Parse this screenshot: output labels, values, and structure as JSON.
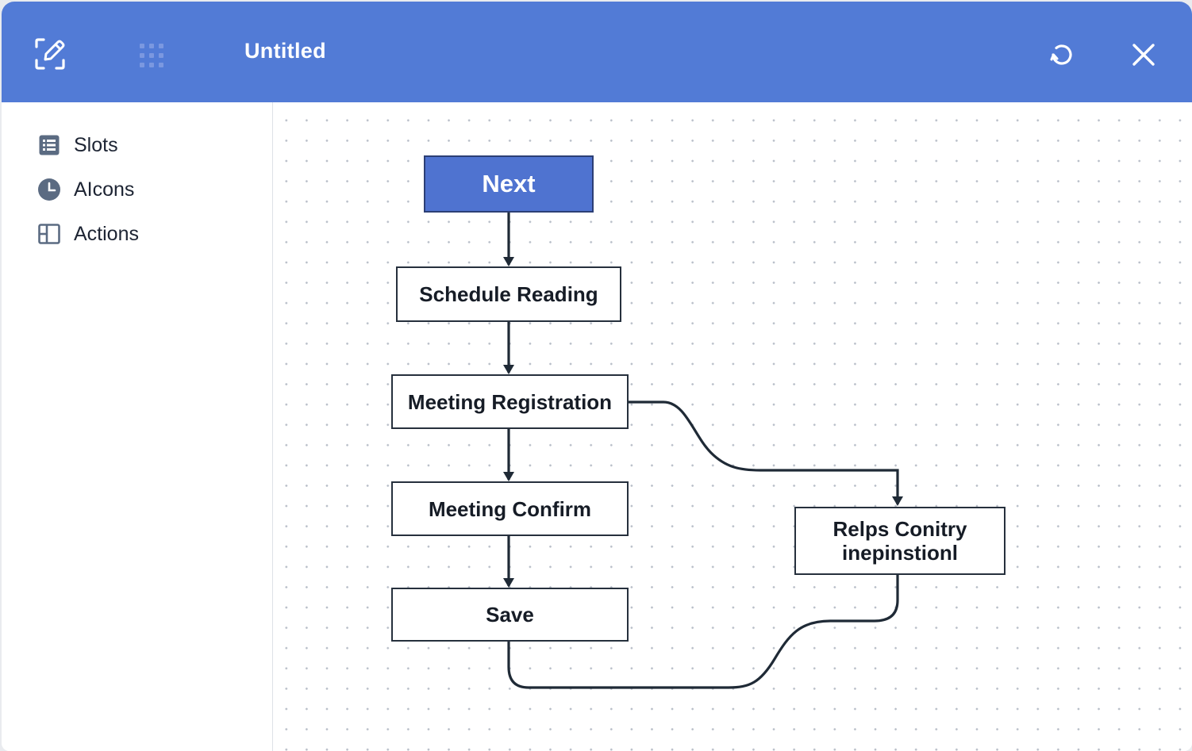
{
  "window": {
    "title": "Untitled"
  },
  "toolbar": {
    "icons": [
      "edit-icon",
      "grid-icon",
      "refresh-icon",
      "close-icon"
    ]
  },
  "sidebar": {
    "items": [
      {
        "label": "Slots",
        "icon": "list-icon"
      },
      {
        "label": "AIcons",
        "icon": "clock-icon"
      },
      {
        "label": "Actions",
        "icon": "panel-icon"
      }
    ]
  },
  "flow": {
    "nodes": [
      {
        "id": "next",
        "label": "Next"
      },
      {
        "id": "schedule",
        "label": "Schedule Reading"
      },
      {
        "id": "registration",
        "label": "Meeting Registration"
      },
      {
        "id": "confirm",
        "label": "Meeting Confirm"
      },
      {
        "id": "save",
        "label": "Save"
      },
      {
        "id": "relps",
        "label": "Relps Conitry\ninepinstionl"
      }
    ],
    "edges": [
      [
        "next",
        "schedule"
      ],
      [
        "schedule",
        "registration"
      ],
      [
        "registration",
        "confirm"
      ],
      [
        "confirm",
        "save"
      ],
      [
        "registration",
        "relps"
      ],
      [
        "relps",
        "save"
      ]
    ]
  },
  "colors": {
    "titlebar": "#527bd6",
    "primary_node": "#4f73d0",
    "edge": "#1f2a36",
    "sidebar_icon": "#5b6b82"
  }
}
